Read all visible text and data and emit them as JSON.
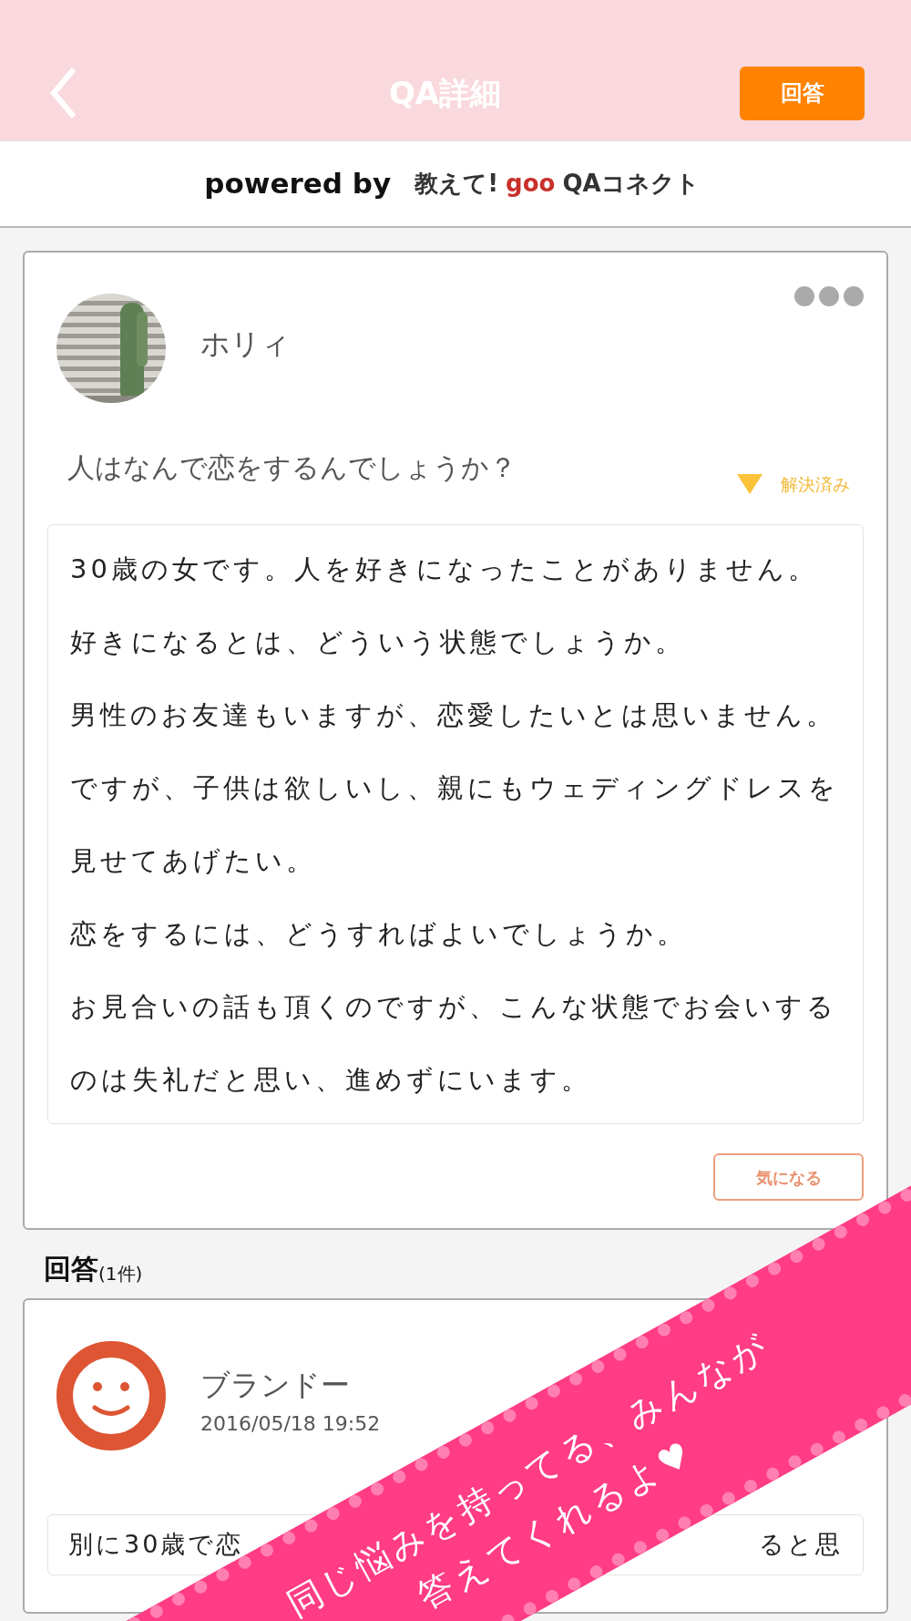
{
  "header": {
    "title": "QA詳細",
    "answer_button": "回答"
  },
  "powered_by": {
    "label": "powered by",
    "logo": [
      "教えて!",
      "goo",
      "QAコネクト"
    ]
  },
  "question": {
    "user": "ホリィ",
    "title": "人はなんで恋をするんでしょうか？",
    "status": "解決済み",
    "follow_button": "気になる",
    "body": [
      "30歳の女です。人を好きになったことがありません。",
      "好きになるとは、どういう状態でしょうか。",
      "男性のお友達もいますが、恋愛したいとは思いません。",
      "ですが、子供は欲しいし、親にもウェディングドレスを見せてあげたい。",
      "恋をするには、どうすればよいでしょうか。",
      "お見合いの話も頂くのですが、こんな状態でお会いするのは失礼だと思い、進めずにいます。"
    ]
  },
  "answers_heading": {
    "label": "回答",
    "count": "(1件)"
  },
  "answers": [
    {
      "user": "ブランドー",
      "date": "2016/05/18 19:52",
      "body_start": "別に30歳で恋",
      "body_end": "ると思"
    }
  ],
  "banner": {
    "lines": [
      "同じ悩みを持ってる、みんなが",
      "答えてくれるよ♥"
    ]
  }
}
